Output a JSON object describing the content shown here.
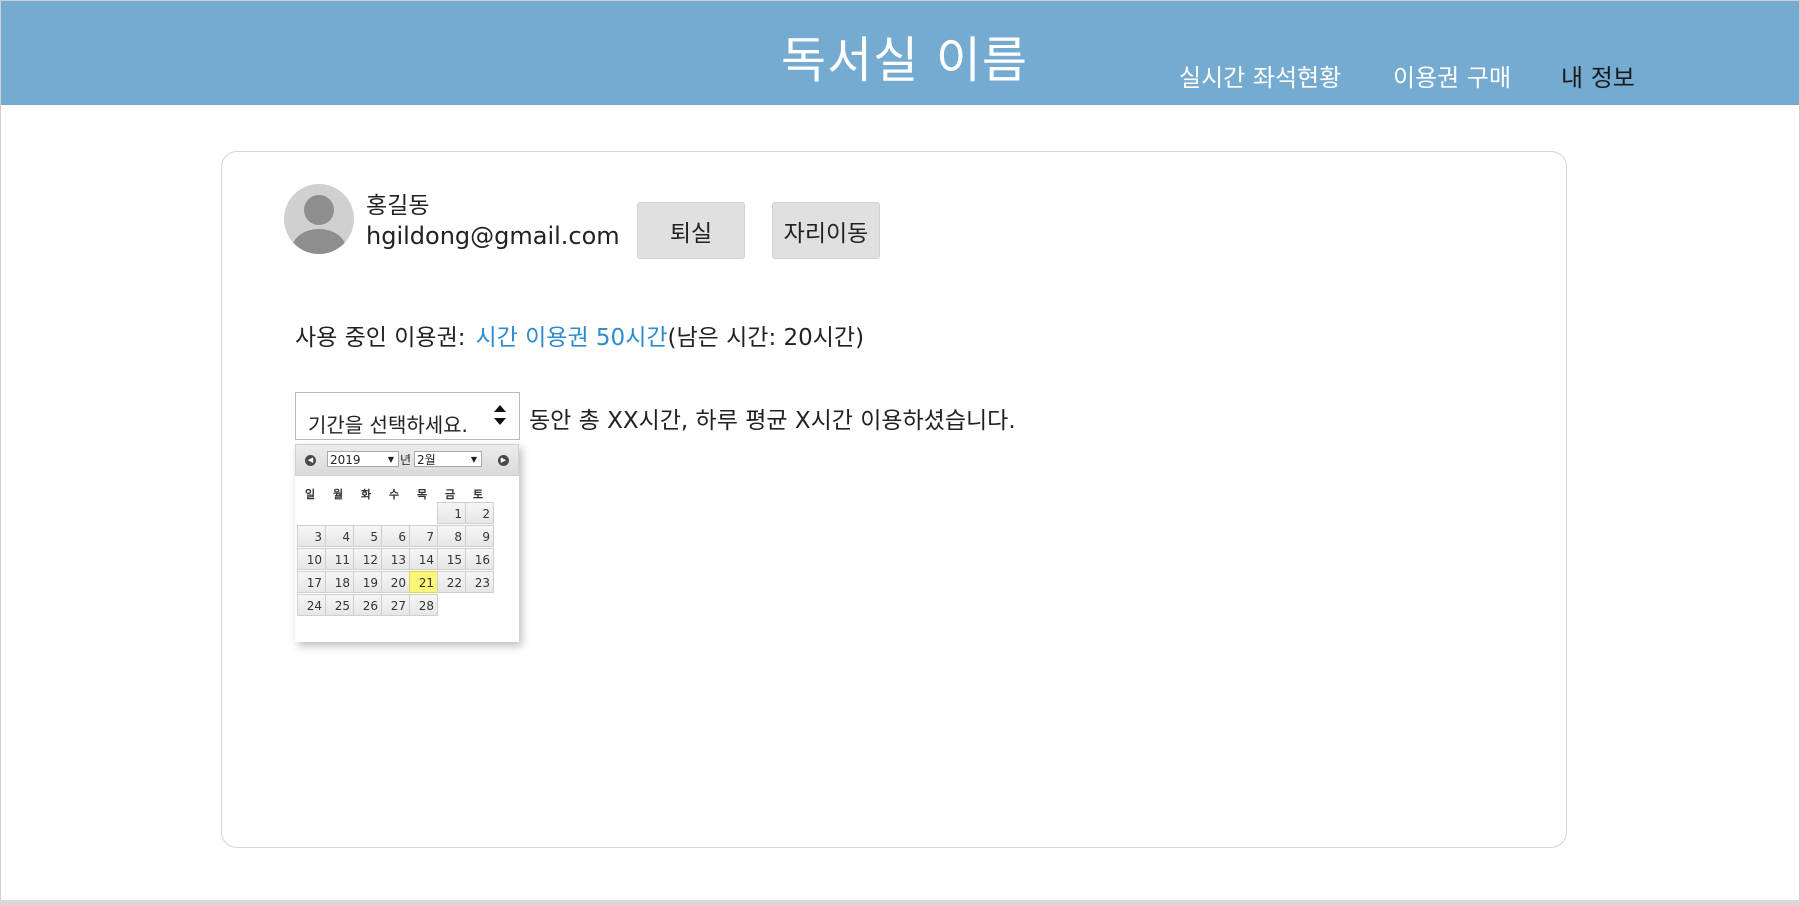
{
  "header": {
    "title": "독서실 이름",
    "nav": {
      "seat_status": "실시간 좌석현황",
      "buy_ticket": "이용권 구매",
      "my_info": "내 정보"
    }
  },
  "profile": {
    "name": "홍길동",
    "email": "hgildong@gmail.com",
    "checkout_label": "퇴실",
    "move_seat_label": "자리이동"
  },
  "ticket": {
    "prefix": "사용 중인 이용권:",
    "name": "시간 이용권 50시간",
    "remaining": "(남은 시간:  20시간)"
  },
  "usage": {
    "period_placeholder": "기간을 선택하세요.",
    "summary": "동안 총 XX시간, 하루 평균 X시간 이용하셨습니다."
  },
  "calendar": {
    "year": "2019",
    "year_suffix": "년",
    "month": "2월",
    "weekdays": [
      "일",
      "월",
      "화",
      "수",
      "목",
      "금",
      "토"
    ],
    "weeks": [
      [
        "",
        "",
        "",
        "",
        "",
        "1",
        "2"
      ],
      [
        "3",
        "4",
        "5",
        "6",
        "7",
        "8",
        "9"
      ],
      [
        "10",
        "11",
        "12",
        "13",
        "14",
        "15",
        "16"
      ],
      [
        "17",
        "18",
        "19",
        "20",
        "21",
        "22",
        "23"
      ],
      [
        "24",
        "25",
        "26",
        "27",
        "28",
        "",
        ""
      ]
    ],
    "today": "21",
    "highlight_color": "#fbf57a"
  },
  "colors": {
    "header_bg": "#76abd1",
    "link_blue": "#2e8bcf"
  }
}
